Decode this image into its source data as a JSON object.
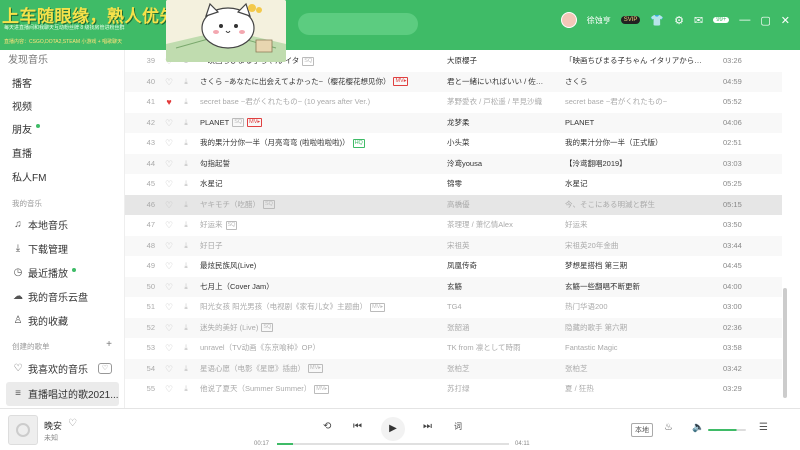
{
  "overlay": {
    "title": "上车随眼缘，熟人优先",
    "line1": "每天进直播间和我聊天互动粉丝牌 8 级找房管进粉丝群",
    "line2": "直播内容：CSGO,DOTA2,STEAM 小游戏 + 唱歌聊天"
  },
  "header": {
    "username": "徐蚀亨",
    "vip": "SVIP",
    "msg_count": "99+",
    "icons": [
      "shirt-icon",
      "gear-icon",
      "mail-icon",
      "minimize-icon",
      "maximize-icon",
      "close-icon"
    ]
  },
  "sidebar": {
    "clipped_label": "发现音乐",
    "items": [
      {
        "label": "播客"
      },
      {
        "label": "视频"
      },
      {
        "label": "朋友"
      },
      {
        "label": "直播"
      },
      {
        "label": "私人FM"
      }
    ],
    "my_music_section": "我的音乐",
    "my_music": [
      {
        "label": "本地音乐",
        "icon": "note-icon"
      },
      {
        "label": "下载管理",
        "icon": "download-icon"
      },
      {
        "label": "最近播放",
        "icon": "clock-icon"
      },
      {
        "label": "我的音乐云盘",
        "icon": "cloud-icon"
      },
      {
        "label": "我的收藏",
        "icon": "user-icon"
      }
    ],
    "created_section": "创建的歌单",
    "plus": "+",
    "playlists": [
      {
        "label": "我喜欢的音乐"
      },
      {
        "label": "直播唱过的歌2021..."
      }
    ],
    "heart_mode": "♡"
  },
  "tracks": [
    {
      "num": "39",
      "title": "「映画ちびまる子ちゃん イタ",
      "tag": "SQ",
      "tag_style": "grey",
      "artist": "大原櫻子",
      "album": "「映画ちびまる子ちゃん イタリアから…",
      "duration": "03:26",
      "grey": false
    },
    {
      "num": "40",
      "title": "さくら ~あなたに出会えてよかった~（樱花樱花想见你）",
      "tag": "MV▸",
      "tag_style": "red",
      "artist": "君と一緒にいればいい / 佐…",
      "album": "さくら",
      "duration": "04:59",
      "grey": false
    },
    {
      "num": "41",
      "title": "secret base ~君がくれたもの~ (10 years after Ver.)",
      "tag": "",
      "tag_style": "",
      "artist": "茅野愛衣 / 戸松遥 / 早見沙織",
      "album": "secret base ~君がくれたもの~",
      "duration": "05:52",
      "grey": true,
      "liked": true
    },
    {
      "num": "42",
      "title": "PLANET",
      "tag": "SQ",
      "tag_style": "grey",
      "tag2": "MV▸",
      "artist": "龙梦柔",
      "album": "PLANET",
      "duration": "04:06",
      "grey": false
    },
    {
      "num": "43",
      "title": "我的果汁分你一半（月亮弯弯 (啦啦啦啦啦)）",
      "tag": "HQ",
      "tag_style": "green",
      "artist": "小头菜",
      "album": "我的果汁分你一半（正式版）",
      "duration": "02:51",
      "grey": false
    },
    {
      "num": "44",
      "title": "勾指起誓",
      "tag": "",
      "tag_style": "",
      "artist": "泠鸢yousa",
      "album": "【泠鸢翻唱2019】",
      "duration": "03:03",
      "grey": false
    },
    {
      "num": "45",
      "title": "水星记",
      "tag": "",
      "tag_style": "",
      "artist": "锦零",
      "album": "水星记",
      "duration": "05:25",
      "grey": false
    },
    {
      "num": "46",
      "title": "ヤキモチ（吃醋）",
      "tag": "SQ",
      "tag_style": "grey",
      "artist": "高橋優",
      "album": "今、そこにある明滅と群生",
      "duration": "05:15",
      "grey": true,
      "selected": true
    },
    {
      "num": "47",
      "title": "好运来",
      "tag": "SQ",
      "tag_style": "grey",
      "artist": "茶理理 / 萧忆情Alex",
      "album": "好运来",
      "duration": "03:50",
      "grey": true
    },
    {
      "num": "48",
      "title": "好日子",
      "tag": "",
      "tag_style": "",
      "artist": "宋祖英",
      "album": "宋祖英20年金曲",
      "duration": "03:44",
      "grey": true
    },
    {
      "num": "49",
      "title": "最炫民族风(Live)",
      "tag": "",
      "tag_style": "",
      "artist": "凤凰传奇",
      "album": "梦想星搭档 第三期",
      "duration": "04:45",
      "grey": false
    },
    {
      "num": "50",
      "title": "七月上（Cover Jam）",
      "tag": "",
      "tag_style": "",
      "artist": "玄觞",
      "album": "玄觞一些翻唱不断更新",
      "duration": "04:00",
      "grey": false
    },
    {
      "num": "51",
      "title": "阳光女孩 阳光男孩（电视剧《家有儿女》主题曲）",
      "tag": "MV▸",
      "tag_style": "grey",
      "artist": "TG4",
      "album": "热门华语200",
      "duration": "03:00",
      "grey": true
    },
    {
      "num": "52",
      "title": "迷失的美好 (Live)",
      "tag": "SQ",
      "tag_style": "grey",
      "artist": "张韶涵",
      "album": "隐藏的歌手 第六期",
      "duration": "02:36",
      "grey": true
    },
    {
      "num": "53",
      "title": "unravel（TV动画《东京喰种》OP）",
      "tag": "",
      "tag_style": "",
      "artist": "TK from 凛として時雨",
      "album": "Fantastic Magic",
      "duration": "03:58",
      "grey": true
    },
    {
      "num": "54",
      "title": "星语心愿（电影《星愿》插曲）",
      "tag": "MV▸",
      "tag_style": "grey",
      "artist": "张柏芝",
      "album": "张柏芝",
      "duration": "03:42",
      "grey": true
    },
    {
      "num": "55",
      "title": "他说了夏天（Summer Summer）",
      "tag": "MV▸",
      "tag_style": "grey",
      "artist": "苏打绿",
      "album": "夏 / 狂热",
      "duration": "03:29",
      "grey": true
    }
  ],
  "player": {
    "song": "晚安",
    "artist": "未知",
    "current_time": "00:17",
    "total_time": "04:11",
    "progress": 0.07,
    "quality": "本地",
    "volume": 0.75
  },
  "colors": {
    "brand_green": "#3fbb67",
    "liked_red": "#e23a3a"
  }
}
